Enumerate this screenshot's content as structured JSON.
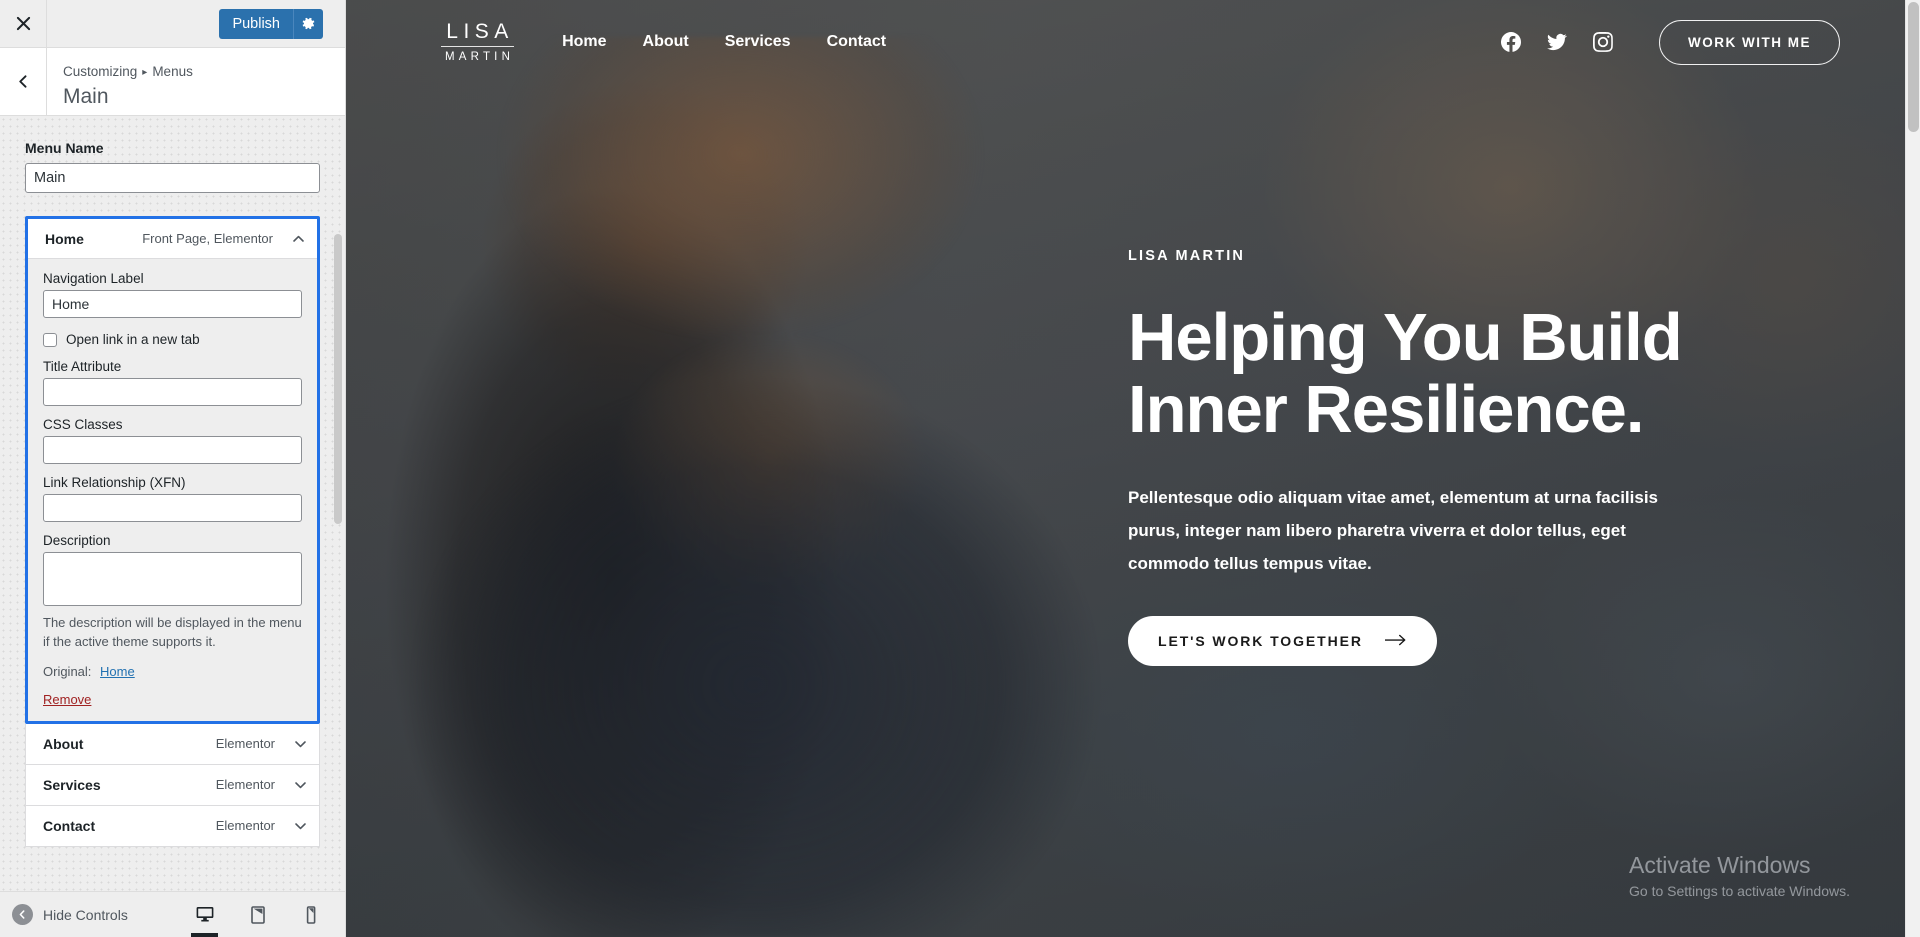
{
  "customizer": {
    "close_label": "Close",
    "publish_label": "Publish",
    "gear_label": "gear",
    "breadcrumb": {
      "root": "Customizing",
      "separator": "▸",
      "section": "Menus"
    },
    "title": "Main",
    "menu_name_label": "Menu Name",
    "menu_name_value": "Main",
    "menu_items": [
      {
        "name": "Home",
        "type": "Front Page, Elementor",
        "expanded": true,
        "fields": {
          "nav_label_label": "Navigation Label",
          "nav_label_value": "Home",
          "new_tab_label": "Open link in a new tab",
          "new_tab_checked": false,
          "title_attr_label": "Title Attribute",
          "title_attr_value": "",
          "css_classes_label": "CSS Classes",
          "css_classes_value": "",
          "xfn_label": "Link Relationship (XFN)",
          "xfn_value": "",
          "description_label": "Description",
          "description_value": "",
          "description_help": "The description will be displayed in the menu if the active theme supports it.",
          "original_label": "Original:",
          "original_link": "Home",
          "remove_label": "Remove"
        }
      },
      {
        "name": "About",
        "type": "Elementor",
        "expanded": false
      },
      {
        "name": "Services",
        "type": "Elementor",
        "expanded": false
      },
      {
        "name": "Contact",
        "type": "Elementor",
        "expanded": false
      }
    ],
    "footer": {
      "hide_controls_label": "Hide Controls",
      "devices": [
        {
          "name": "desktop",
          "active": true
        },
        {
          "name": "tablet",
          "active": false
        },
        {
          "name": "mobile",
          "active": false
        }
      ]
    },
    "accent_blue": "#2271e6",
    "publish_blue": "#2b71ad",
    "remove_red": "#a02222"
  },
  "preview": {
    "logo": {
      "line1": "LISA",
      "line2": "MARTIN"
    },
    "nav_links": [
      "Home",
      "About",
      "Services",
      "Contact"
    ],
    "social_icons": [
      "facebook-icon",
      "twitter-icon",
      "instagram-icon"
    ],
    "header_cta": "WORK WITH ME",
    "hero": {
      "eyebrow": "LISA MARTIN",
      "title_line1": "Helping You Build",
      "title_line2": "Inner Resilience.",
      "paragraph": "Pellentesque odio aliquam vitae amet, elementum at urna facilisis purus, integer nam libero pharetra viverra et dolor tellus, eget commodo tellus tempus vitae.",
      "cta_label": "LET'S WORK TOGETHER"
    },
    "watermark": {
      "title": "Activate Windows",
      "subtitle": "Go to Settings to activate Windows."
    }
  }
}
